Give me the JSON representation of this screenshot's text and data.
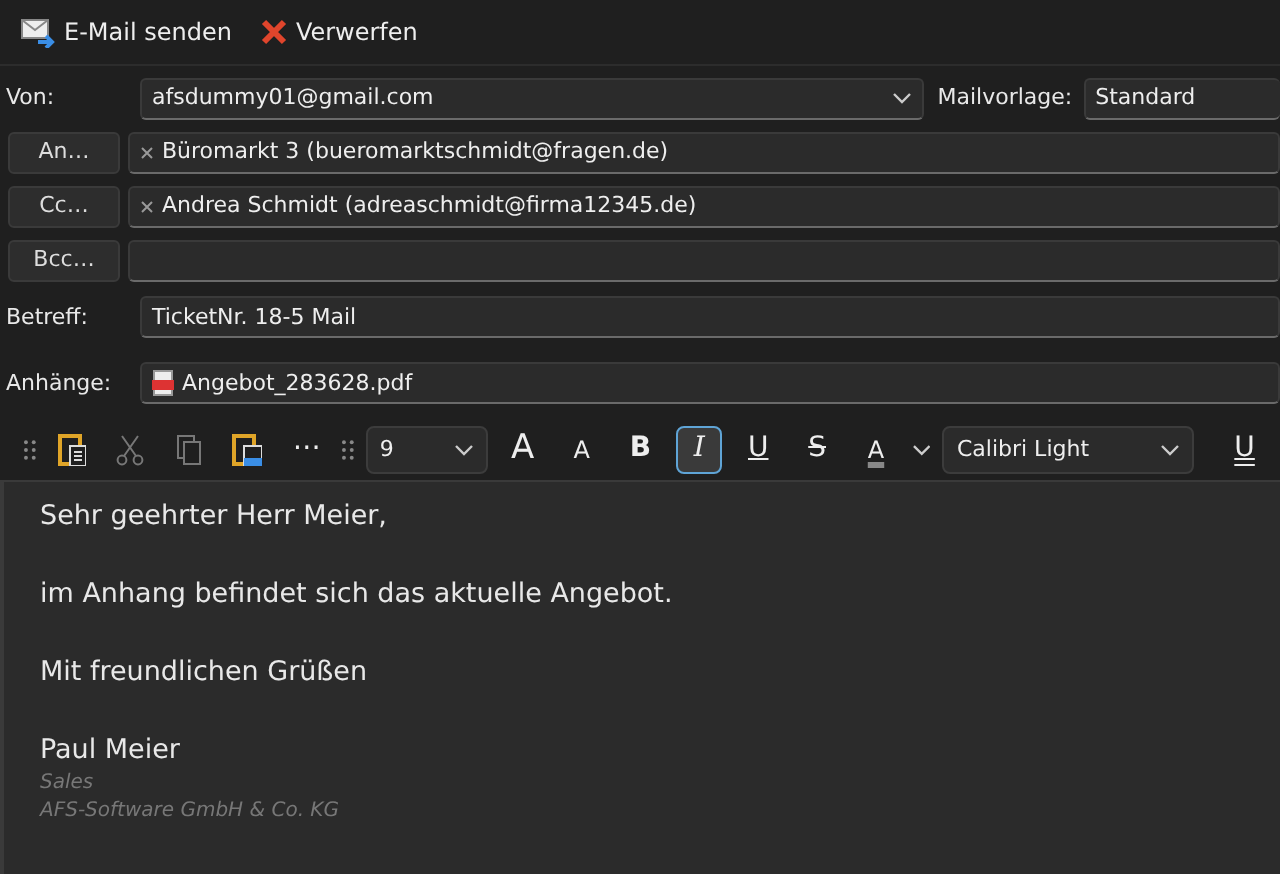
{
  "toolbar": [
    {
      "kind": "send",
      "label": "E-Mail senden"
    },
    {
      "kind": "discard",
      "label": "Verwerfen"
    }
  ],
  "from": {
    "label": "Von:",
    "value": "afsdummy01@gmail.com"
  },
  "template": {
    "label": "Mailvorlage:",
    "value": "Standard"
  },
  "recipients": [
    {
      "button": "An…",
      "chips": [
        "Büromarkt 3 (bueromarktschmidt@fragen.de)"
      ]
    },
    {
      "button": "Cc…",
      "chips": [
        "Andrea Schmidt (adreaschmidt@firma12345.de)"
      ]
    },
    {
      "button": "Bcc…"
    }
  ],
  "subject": {
    "label": "Betreff:",
    "value": "TicketNr. 18-5 Mail"
  },
  "attachments": {
    "label": "Anhänge:",
    "files": [
      "Angebot_283628.pdf"
    ]
  },
  "format_bar": [
    {
      "kind": "grip"
    },
    {
      "kind": "paste",
      "disabled": false
    },
    {
      "kind": "cut",
      "disabled": true
    },
    {
      "kind": "copy",
      "disabled": true
    },
    {
      "kind": "paste-special",
      "disabled": false
    },
    {
      "kind": "more",
      "label": "⋯"
    },
    {
      "kind": "grip"
    },
    {
      "kind": "size-select",
      "value": "9"
    },
    {
      "kind": "grow",
      "label": "A",
      "selected": false
    },
    {
      "kind": "shrink",
      "label": "A",
      "selected": false
    },
    {
      "kind": "bold",
      "label": "B",
      "selected": false
    },
    {
      "kind": "italic",
      "label": "I",
      "selected": true
    },
    {
      "kind": "underline",
      "label": "U",
      "selected": false
    },
    {
      "kind": "strike",
      "label": "S",
      "selected": false
    },
    {
      "kind": "color",
      "label": "A",
      "selected": false
    },
    {
      "kind": "caret"
    },
    {
      "kind": "font-select",
      "value": "Calibri Light"
    },
    {
      "kind": "dunderline",
      "label": "U",
      "selected": false
    }
  ],
  "body": [
    {
      "kind": "text",
      "text": "Sehr geehrter Herr Meier,"
    },
    {
      "kind": "gap"
    },
    {
      "kind": "text",
      "text": "im Anhang befindet sich das aktuelle Angebot."
    },
    {
      "kind": "gap"
    },
    {
      "kind": "text",
      "text": "Mit freundlichen Grüßen"
    },
    {
      "kind": "gap"
    },
    {
      "kind": "text",
      "text": "Paul Meier"
    },
    {
      "kind": "signature",
      "text": "Sales"
    },
    {
      "kind": "signature",
      "text": "AFS-Software GmbH & Co. KG"
    }
  ]
}
